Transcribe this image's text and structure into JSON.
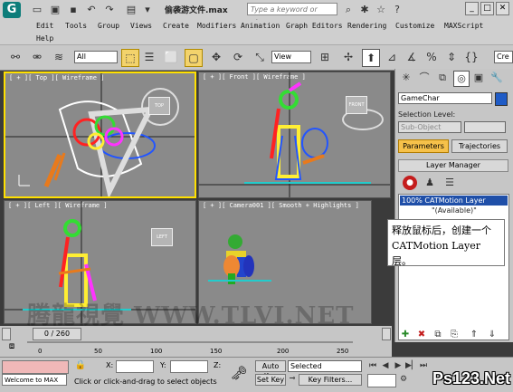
{
  "window": {
    "doc_title": "偷袭游文件.max",
    "search_placeholder": "Type a keyword or phrase",
    "logo_glyph": "G"
  },
  "menu": [
    "Edit",
    "Tools",
    "Group",
    "Views",
    "Create",
    "Modifiers",
    "Animation",
    "Graph Editors",
    "Rendering",
    "Customize",
    "MAXScript",
    "Help"
  ],
  "toolbar": {
    "selection_filter": "All",
    "ref_coord": "View",
    "named_sel": "Cre"
  },
  "viewports": {
    "top": "[ + ][ Top ][ Wireframe ]",
    "front": "[ + ][ Front ][ Wireframe ]",
    "left": "[ + ][ Left ][ Wireframe ]",
    "camera": "[ + ][ Camera001 ][ Smooth + Highlights ]",
    "cube_top": "TOP",
    "cube_front": "FRONT",
    "cube_left": "LEFT"
  },
  "panel": {
    "object_name": "GameChar",
    "selection_level_label": "Selection Level:",
    "sub_object_value": "Sub-Object",
    "tab_parameters": "Parameters",
    "tab_trajectories": "Trajectories",
    "rollout_title": "Layer Manager",
    "layer_item": "100% CATMotion Layer",
    "layer_status": "\"(Available)\""
  },
  "callout": {
    "line1": "释放鼠标后，创建一个",
    "line2": "CATMotion Layer 层。"
  },
  "timeline": {
    "slider_label": "0 / 260",
    "ticks": [
      "0",
      "50",
      "100",
      "150",
      "200",
      "250"
    ]
  },
  "status": {
    "maxscript_text": "Welcome to MAX",
    "prompt": "Click or click-and-drag to select objects",
    "x_label": "X:",
    "y_label": "Y:",
    "z_label": "Z:",
    "auto_key": "Auto Key",
    "set_key": "Set Key",
    "selected": "Selected",
    "key_filters": "Key Filters..."
  },
  "watermark": {
    "text": "腾龍視覺 WWW.TLVI.NET",
    "brand": "Ps123.Net"
  },
  "colors": {
    "active_border": "#ffe000",
    "viewport_bg": "#8a8a8a",
    "tab_active": "#f6c14a",
    "layer_selected": "#1f4fa8",
    "record": "#c41d1d"
  }
}
